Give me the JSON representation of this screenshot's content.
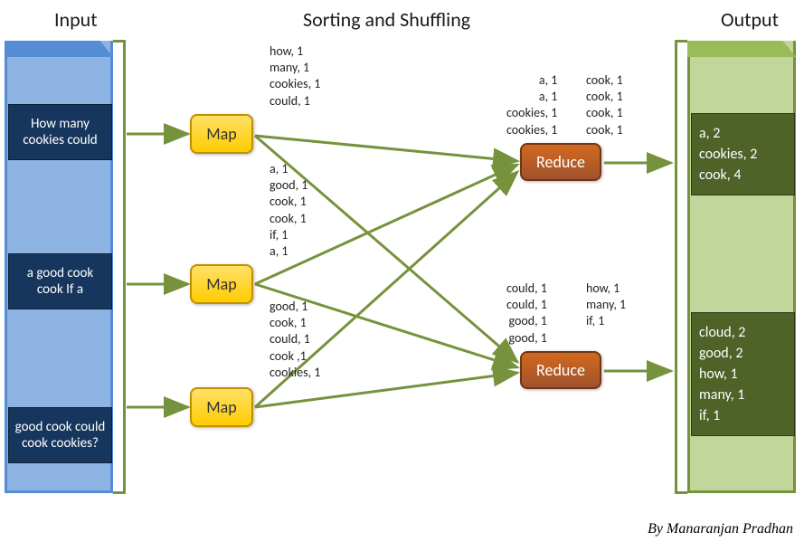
{
  "headers": {
    "input": "Input",
    "shuffle": "Sorting and Shuffling",
    "output": "Output"
  },
  "input_blocks": [
    "How many cookies could",
    "a good cook cook If a",
    "good cook could cook cookies?"
  ],
  "map_label": "Map",
  "reduce_label": "Reduce",
  "map_outputs": [
    [
      "how, 1",
      "many, 1",
      "cookies, 1",
      "could, 1"
    ],
    [
      "a, 1",
      "good, 1",
      "cook, 1",
      "cook, 1",
      "if, 1",
      "a, 1"
    ],
    [
      "good, 1",
      "cook, 1",
      "could, 1",
      "cook ,1",
      "cookies, 1"
    ]
  ],
  "reduce_inputs": [
    {
      "col1": [
        "a, 1",
        "a, 1",
        "cookies, 1",
        "cookies, 1"
      ],
      "col2": [
        "cook, 1",
        "cook, 1",
        "cook, 1",
        "cook, 1"
      ]
    },
    {
      "col1": [
        "could, 1",
        "could, 1",
        "good, 1",
        "good, 1"
      ],
      "col2": [
        "how, 1",
        "many, 1",
        "if, 1"
      ]
    }
  ],
  "output_blocks": [
    [
      "a, 2",
      "cookies, 2",
      "cook, 4"
    ],
    [
      "cloud, 2",
      "good, 2",
      "how, 1",
      "many, 1",
      "if, 1"
    ]
  ],
  "credit": "By Manaranjan Pradhan"
}
